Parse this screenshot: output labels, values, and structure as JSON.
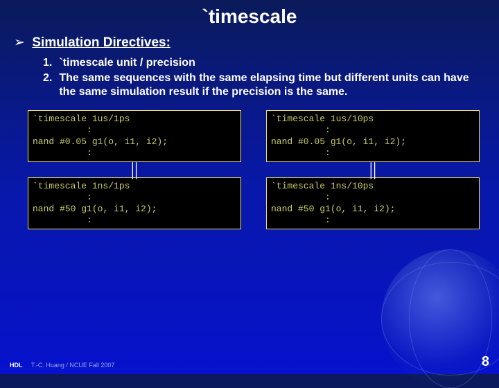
{
  "title": "`timescale",
  "section": {
    "bullet": "➢",
    "header": "Simulation Directives:"
  },
  "list": [
    {
      "num": "1.",
      "text": "`timescale unit / precision"
    },
    {
      "num": "2.",
      "text": "The same sequences with the same elapsing time but different units can have the same simulation result if the precision is the same."
    }
  ],
  "equiv_symbol": "||",
  "code": {
    "left_top": "`timescale 1us/1ps\n          :\nnand #0.05 g1(o, i1, i2);\n          :",
    "left_bottom": "`timescale 1ns/1ps\n          :\nnand #50 g1(o, i1, i2);\n          :",
    "right_top": "`timescale 1us/10ps\n          :\nnand #0.05 g1(o, i1, i2);\n          :",
    "right_bottom": "`timescale 1ns/10ps\n          :\nnand #50 g1(o, i1, i2);\n          :"
  },
  "footer": {
    "hdl": "HDL",
    "credit": "T.-C. Huang / NCUE  Fall 2007"
  },
  "page": "8"
}
